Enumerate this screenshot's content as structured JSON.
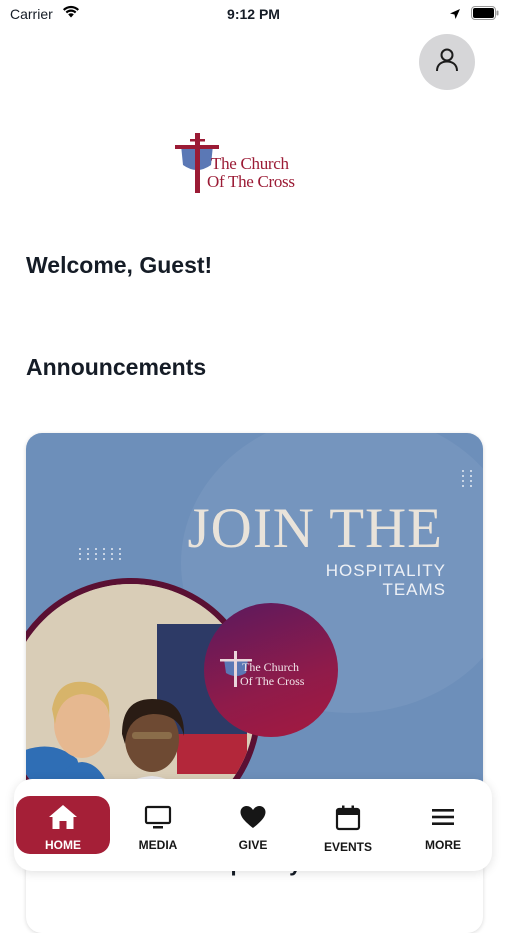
{
  "status_bar": {
    "carrier": "Carrier",
    "time": "9:12 PM"
  },
  "logo": {
    "line1": "The Church",
    "line2": "Of The Cross"
  },
  "welcome": "Welcome, Guest!",
  "announcements": {
    "section_title": "Announcements",
    "items": [
      {
        "banner_headline": "JOIN THE",
        "banner_subline1": "HOSPITALITY",
        "banner_subline2": "TEAMS",
        "badge_line1": "The Church",
        "badge_line2": "Of The Cross",
        "title": "SPOTLIGHT: Hospitality Teams"
      }
    ]
  },
  "tabs": [
    {
      "label": "HOME",
      "icon": "home-icon",
      "active": true
    },
    {
      "label": "MEDIA",
      "icon": "tv-icon"
    },
    {
      "label": "GIVE",
      "icon": "heart-icon"
    },
    {
      "label": "EVENTS",
      "icon": "calendar-icon"
    },
    {
      "label": "MORE",
      "icon": "menu-icon"
    }
  ],
  "colors": {
    "brand": "#a51f37",
    "banner": "#6d8fba"
  }
}
